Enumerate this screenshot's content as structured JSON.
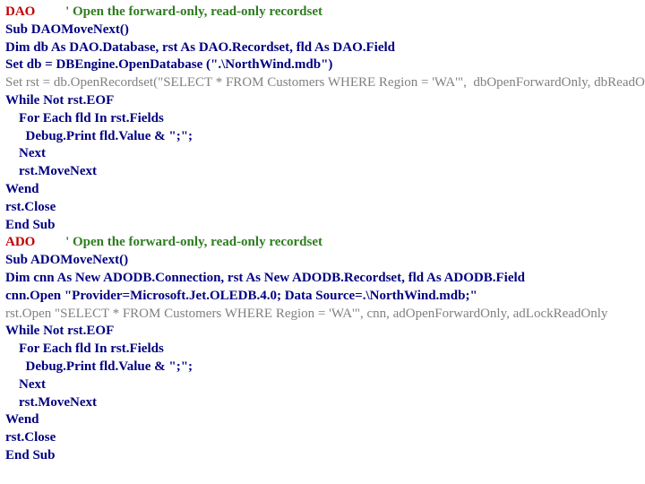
{
  "lines": [
    {
      "segments": [
        {
          "cls": "red",
          "text": "DAO"
        },
        {
          "cls": "green",
          "text": "         ' Open the forward-only, read-only recordset"
        }
      ]
    },
    {
      "segments": [
        {
          "cls": "navy",
          "text": "Sub DAOMoveNext()"
        }
      ]
    },
    {
      "segments": [
        {
          "cls": "navy",
          "text": "Dim db As DAO.Database, rst As DAO.Recordset, fld As DAO.Field"
        }
      ]
    },
    {
      "segments": [
        {
          "cls": "navy",
          "text": "Set db = DBEngine.OpenDatabase (\".\\NorthWind.mdb\")"
        }
      ]
    },
    {
      "segments": [
        {
          "cls": "gray",
          "text": "Set rst = db.OpenRecordset(\"SELECT * FROM Customers WHERE Region = 'WA'\",  dbOpenForwardOnly, dbReadOnly)"
        }
      ]
    },
    {
      "segments": [
        {
          "cls": "navy",
          "text": "While Not rst.EOF"
        }
      ]
    },
    {
      "segments": [
        {
          "cls": "navy",
          "text": "    For Each fld In rst.Fields"
        }
      ]
    },
    {
      "segments": [
        {
          "cls": "navy",
          "text": "      Debug.Print fld.Value & \";\";"
        }
      ]
    },
    {
      "segments": [
        {
          "cls": "navy",
          "text": "    Next"
        }
      ]
    },
    {
      "segments": [
        {
          "cls": "navy",
          "text": "    rst.MoveNext"
        }
      ]
    },
    {
      "segments": [
        {
          "cls": "navy",
          "text": "Wend"
        }
      ]
    },
    {
      "segments": [
        {
          "cls": "navy",
          "text": "rst.Close"
        }
      ]
    },
    {
      "segments": [
        {
          "cls": "navy",
          "text": "End Sub"
        }
      ]
    },
    {
      "segments": [
        {
          "cls": "red",
          "text": "ADO"
        },
        {
          "cls": "green",
          "text": "         ' Open the forward-only, read-only recordset"
        }
      ]
    },
    {
      "segments": [
        {
          "cls": "navy",
          "text": "Sub ADOMoveNext()"
        }
      ]
    },
    {
      "segments": [
        {
          "cls": "navy",
          "text": "Dim cnn As New ADODB.Connection, rst As New ADODB.Recordset, fld As ADODB.Field"
        }
      ]
    },
    {
      "segments": [
        {
          "cls": "navy",
          "text": "cnn.Open \"Provider=Microsoft.Jet.OLEDB.4.0; Data Source=.\\NorthWind.mdb;\""
        }
      ]
    },
    {
      "segments": [
        {
          "cls": "gray",
          "text": "rst.Open \"SELECT * FROM Customers WHERE Region = 'WA'\", cnn, adOpenForwardOnly, adLockReadOnly"
        }
      ]
    },
    {
      "segments": [
        {
          "cls": "navy",
          "text": "While Not rst.EOF"
        }
      ]
    },
    {
      "segments": [
        {
          "cls": "navy",
          "text": "    For Each fld In rst.Fields"
        }
      ]
    },
    {
      "segments": [
        {
          "cls": "navy",
          "text": "      Debug.Print fld.Value & \";\";"
        }
      ]
    },
    {
      "segments": [
        {
          "cls": "navy",
          "text": "    Next"
        }
      ]
    },
    {
      "segments": [
        {
          "cls": "navy",
          "text": "    rst.MoveNext"
        }
      ]
    },
    {
      "segments": [
        {
          "cls": "navy",
          "text": "Wend"
        }
      ]
    },
    {
      "segments": [
        {
          "cls": "navy",
          "text": "rst.Close"
        }
      ]
    },
    {
      "segments": [
        {
          "cls": "navy",
          "text": "End Sub"
        }
      ]
    }
  ]
}
